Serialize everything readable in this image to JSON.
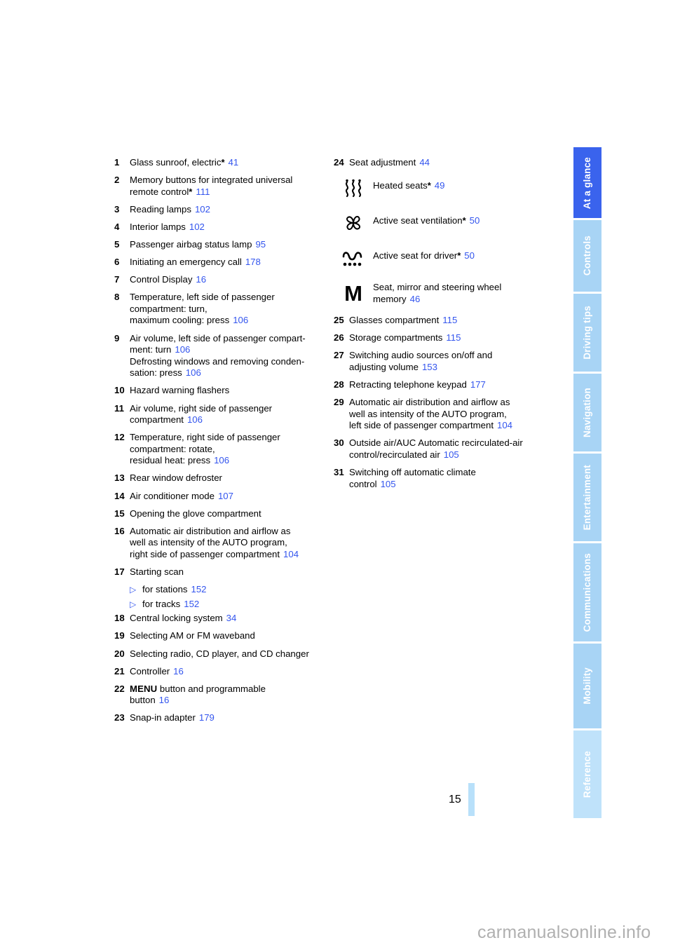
{
  "document": {
    "page_number": "15",
    "watermark": "carmanualsonline.info"
  },
  "tab_rail": {
    "tabs": [
      {
        "label": "At a glance",
        "state": "active"
      },
      {
        "label": "Controls",
        "state": "inactive"
      },
      {
        "label": "Driving tips",
        "state": "inactive"
      },
      {
        "label": "Navigation",
        "state": "inactive"
      },
      {
        "label": "Entertainment",
        "state": "inactive"
      },
      {
        "label": "Communications",
        "state": "inactive"
      },
      {
        "label": "Mobility",
        "state": "inactive"
      },
      {
        "label": "Reference",
        "state": "faint"
      }
    ],
    "active_color": "#3a63ed",
    "inactive_color": "#a8d4f5",
    "faint_color": "#bfe2fa"
  },
  "colors": {
    "page_reference": "#3355ee",
    "text": "#000000",
    "watermark": "#b0b0b0",
    "footer_bar": "#b8e0fa"
  },
  "left_column": {
    "items": [
      {
        "num": "1",
        "lines": [
          {
            "text": "Glass sunroof, electric",
            "star": true,
            "ref": "41"
          }
        ]
      },
      {
        "num": "2",
        "lines": [
          {
            "text": "Memory buttons for integrated universal"
          },
          {
            "text": "remote control",
            "star": true,
            "ref": "111"
          }
        ]
      },
      {
        "num": "3",
        "lines": [
          {
            "text": "Reading lamps",
            "ref": "102"
          }
        ]
      },
      {
        "num": "4",
        "lines": [
          {
            "text": "Interior lamps",
            "ref": "102"
          }
        ]
      },
      {
        "num": "5",
        "lines": [
          {
            "text": "Passenger airbag status lamp",
            "ref": "95"
          }
        ]
      },
      {
        "num": "6",
        "lines": [
          {
            "text": "Initiating an emergency call",
            "ref": "178"
          }
        ]
      },
      {
        "num": "7",
        "lines": [
          {
            "text": "Control Display",
            "ref": "16"
          }
        ]
      },
      {
        "num": "8",
        "lines": [
          {
            "text": "Temperature, left side of passenger"
          },
          {
            "text": "compartment: turn,"
          },
          {
            "text": "maximum cooling: press",
            "ref": "106"
          }
        ]
      },
      {
        "num": "9",
        "lines": [
          {
            "text": "Air volume, left side of passenger compart-"
          },
          {
            "text": "ment: turn",
            "ref": "106"
          },
          {
            "text": "Defrosting windows and removing conden-"
          },
          {
            "text": "sation: press",
            "ref": "106"
          }
        ]
      },
      {
        "num": "10",
        "lines": [
          {
            "text": "Hazard warning flashers"
          }
        ]
      },
      {
        "num": "11",
        "lines": [
          {
            "text": "Air volume, right side of passenger"
          },
          {
            "text": "compartment",
            "ref": "106"
          }
        ]
      },
      {
        "num": "12",
        "lines": [
          {
            "text": "Temperature, right side of passenger"
          },
          {
            "text": "compartment: rotate,"
          },
          {
            "text": "residual heat: press",
            "ref": "106"
          }
        ]
      },
      {
        "num": "13",
        "lines": [
          {
            "text": "Rear window defroster"
          }
        ]
      },
      {
        "num": "14",
        "lines": [
          {
            "text": "Air conditioner mode",
            "ref": "107"
          }
        ]
      },
      {
        "num": "15",
        "lines": [
          {
            "text": "Opening the glove compartment"
          }
        ]
      },
      {
        "num": "16",
        "lines": [
          {
            "text": "Automatic air distribution and airflow as"
          },
          {
            "text": "well as intensity of the AUTO program,"
          },
          {
            "text": "right side of passenger compartment",
            "ref": "104"
          }
        ]
      },
      {
        "num": "17",
        "lines": [
          {
            "text": "Starting scan"
          }
        ],
        "subitems": [
          {
            "bullet": "triangle-right-icon",
            "text": "for stations",
            "ref": "152"
          },
          {
            "bullet": "triangle-right-icon",
            "text": "for tracks",
            "ref": "152"
          }
        ]
      },
      {
        "num": "18",
        "lines": [
          {
            "text": "Central locking system",
            "ref": "34"
          }
        ]
      },
      {
        "num": "19",
        "lines": [
          {
            "text": "Selecting AM or FM waveband"
          }
        ]
      },
      {
        "num": "20",
        "lines": [
          {
            "text": "Selecting radio, CD player, and CD changer"
          }
        ]
      },
      {
        "num": "21",
        "lines": [
          {
            "text": "Controller",
            "ref": "16"
          }
        ]
      },
      {
        "num": "22",
        "lines": [
          {
            "kbd": "MENU",
            "text": " button and programmable"
          },
          {
            "text": "button",
            "ref": "16"
          }
        ]
      },
      {
        "num": "23",
        "lines": [
          {
            "text": "Snap-in adapter",
            "ref": "179"
          }
        ]
      }
    ]
  },
  "right_column": {
    "items": [
      {
        "num": "24",
        "lines": [
          {
            "text": "Seat adjustment",
            "ref": "44"
          }
        ]
      },
      {
        "icon": "heated-seats-icon",
        "lines": [
          {
            "text": "Heated seats",
            "star": true,
            "ref": "49"
          }
        ]
      },
      {
        "icon": "seat-ventilation-fan-icon",
        "lines": [
          {
            "text": "Active seat ventilation",
            "star": true,
            "ref": "50"
          }
        ]
      },
      {
        "icon": "active-seat-icon",
        "lines": [
          {
            "text": "Active seat for driver",
            "star": true,
            "ref": "50"
          }
        ]
      },
      {
        "icon": "memory-m-icon",
        "icon_glyph": "M",
        "lines": [
          {
            "text": "Seat, mirror and steering wheel"
          },
          {
            "text": "memory",
            "ref": "46"
          }
        ]
      },
      {
        "num": "25",
        "lines": [
          {
            "text": "Glasses compartment",
            "ref": "115"
          }
        ]
      },
      {
        "num": "26",
        "lines": [
          {
            "text": "Storage compartments",
            "ref": "115"
          }
        ]
      },
      {
        "num": "27",
        "lines": [
          {
            "text": "Switching audio sources on/off and"
          },
          {
            "text": "adjusting volume",
            "ref": "153"
          }
        ]
      },
      {
        "num": "28",
        "lines": [
          {
            "text": "Retracting telephone keypad",
            "ref": "177"
          }
        ]
      },
      {
        "num": "29",
        "lines": [
          {
            "text": "Automatic air distribution and airflow as"
          },
          {
            "text": "well as intensity of the AUTO program,"
          },
          {
            "text": "left side of passenger compartment",
            "ref": "104"
          }
        ]
      },
      {
        "num": "30",
        "lines": [
          {
            "text": "Outside air/AUC Automatic recirculated-air"
          },
          {
            "text": "control/recirculated air",
            "ref": "105"
          }
        ]
      },
      {
        "num": "31",
        "lines": [
          {
            "text": "Switching off automatic climate"
          },
          {
            "text": "control",
            "ref": "105"
          }
        ]
      }
    ]
  }
}
